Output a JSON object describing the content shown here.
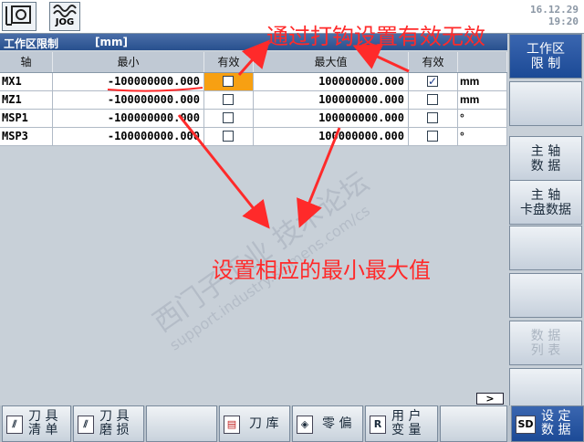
{
  "topbar": {
    "mode_label": "JOG",
    "date": "16.12.29",
    "time": "19:20"
  },
  "header": {
    "title": "工作区限制",
    "unit": "[mm]"
  },
  "table": {
    "columns": [
      "轴",
      "最小",
      "有效",
      "最大值",
      "有效"
    ],
    "rows": [
      {
        "axis": "MX1",
        "min": "-100000000.000",
        "min_active": false,
        "max": "100000000.000",
        "max_active": true,
        "unit": "mm"
      },
      {
        "axis": "MZ1",
        "min": "-100000000.000",
        "min_active": false,
        "max": "100000000.000",
        "max_active": false,
        "unit": "mm"
      },
      {
        "axis": "MSP1",
        "min": "-100000000.000",
        "min_active": false,
        "max": "100000000.000",
        "max_active": false,
        "unit": "°"
      },
      {
        "axis": "MSP3",
        "min": "-100000000.000",
        "min_active": false,
        "max": "100000000.000",
        "max_active": false,
        "unit": "°"
      }
    ]
  },
  "side_keys": [
    {
      "label_1": "工作区",
      "label_2": "限 制",
      "active": true
    },
    {
      "label_1": "",
      "label_2": ""
    },
    {
      "label_1": "主 轴",
      "label_2": "数 据"
    },
    {
      "label_1": "主 轴",
      "label_2": "卡盘数据"
    },
    {
      "label_1": "",
      "label_2": ""
    },
    {
      "label_1": "",
      "label_2": ""
    },
    {
      "label_1": "数 据",
      "label_2": "列 表",
      "disabled": true
    },
    {
      "label_1": "",
      "label_2": ""
    }
  ],
  "bottom_keys": [
    {
      "label_1": "刀 具",
      "label_2": "清 单",
      "icon": "tool-list-icon"
    },
    {
      "label_1": "刀 具",
      "label_2": "磨 损",
      "icon": "tool-wear-icon"
    },
    {
      "label_1": "",
      "label_2": ""
    },
    {
      "label_1": "刀 库",
      "icon": "magazine-icon"
    },
    {
      "label_1": "零 偏",
      "icon": "zero-offset-icon"
    },
    {
      "label_1": "用 户",
      "label_2": "变 量",
      "icon": "R"
    },
    {
      "label_1": "",
      "label_2": ""
    },
    {
      "label_1": "设 定",
      "label_2": "数 据",
      "icon": "SD",
      "active": true
    }
  ],
  "scroll_right": ">",
  "annotations": {
    "top_note": "通过打钩设置有效无效",
    "center_note": "设置相应的最小最大值"
  },
  "watermark": {
    "line1": "西门子工业 技术论坛",
    "line2": "support.industry.siemens.com/cs"
  },
  "colors": {
    "header_blue": "#28508e",
    "highlight_orange": "#f7a012",
    "annotation_red": "#ff2a2a"
  }
}
